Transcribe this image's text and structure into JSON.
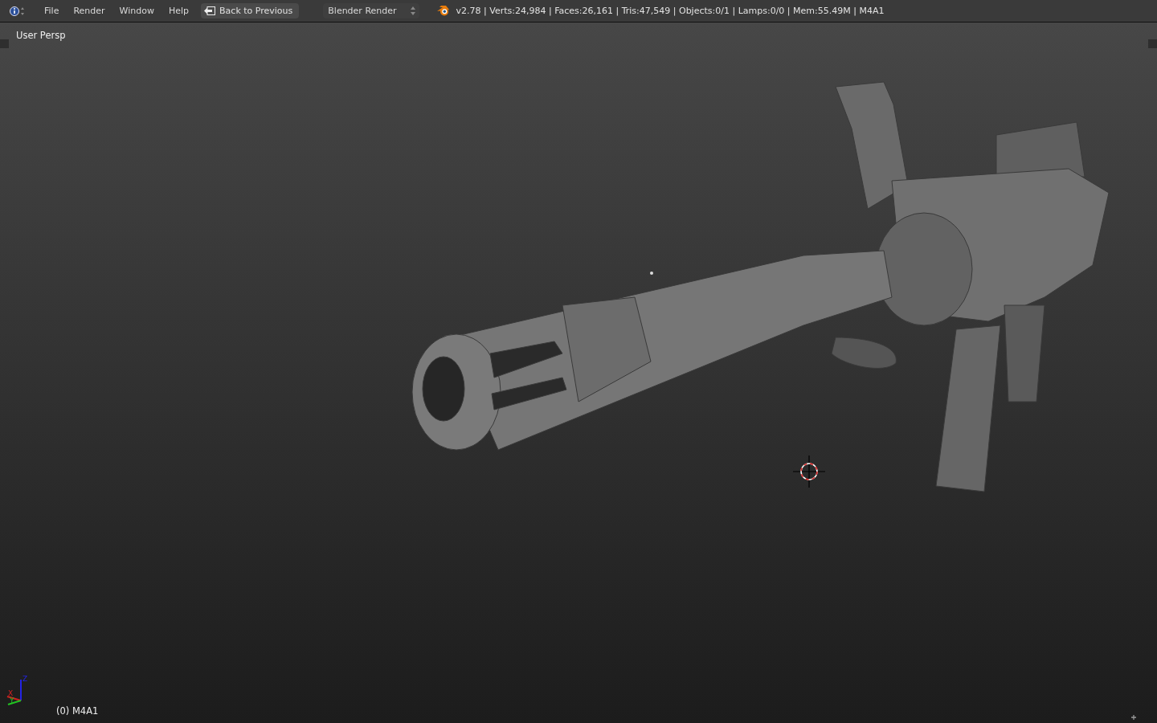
{
  "header": {
    "menus": [
      "File",
      "Render",
      "Window",
      "Help"
    ],
    "back_button": "Back to Previous",
    "render_engine": "Blender Render",
    "stats": "v2.78 | Verts:24,984 | Faces:26,161 | Tris:47,549 | Objects:0/1 | Lamps:0/0 | Mem:55.49M | M4A1"
  },
  "viewport": {
    "view_name": "User Persp",
    "object_label": "(0) M4A1",
    "axes": {
      "x": "X",
      "y": "Y",
      "z": "Z"
    }
  }
}
